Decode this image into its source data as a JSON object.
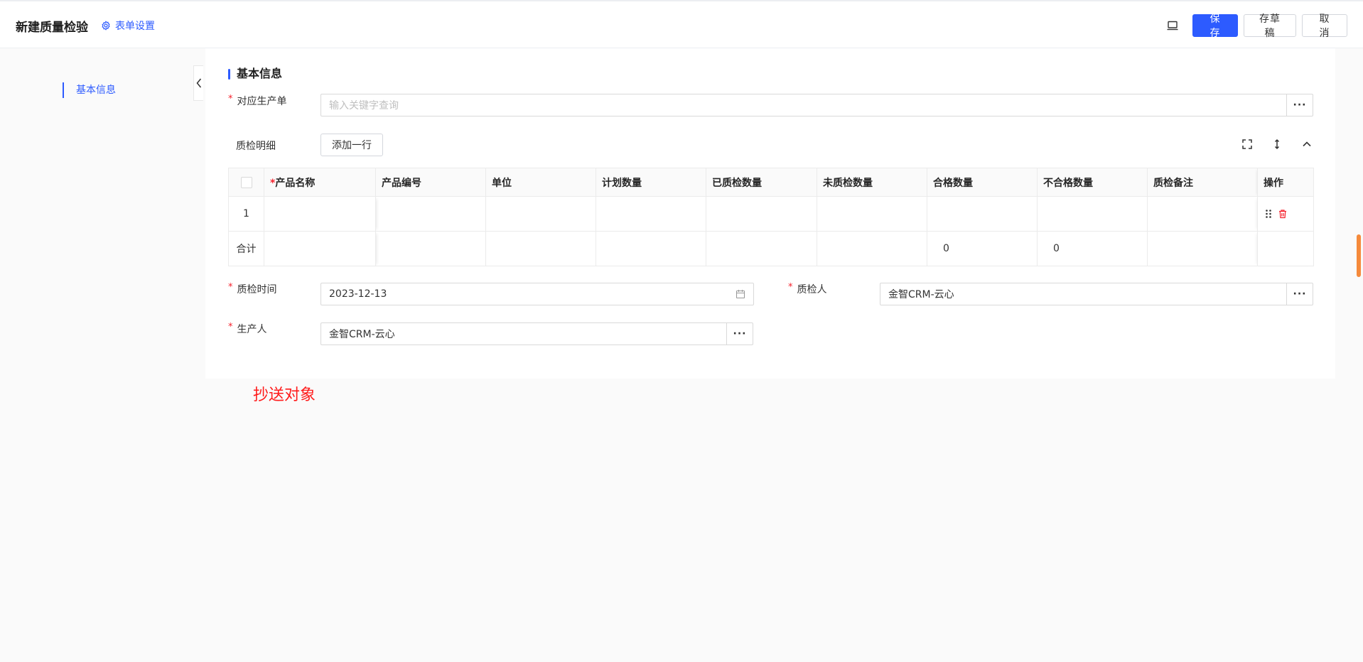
{
  "header": {
    "title": "新建质量检验",
    "form_settings": "表单设置",
    "save": "保 存",
    "draft": "存草稿",
    "cancel": "取 消"
  },
  "nav": {
    "items": [
      {
        "label": "基本信息",
        "active": true
      }
    ]
  },
  "section": {
    "title": "基本信息",
    "production_order": {
      "label": "对应生产单",
      "placeholder": "输入关键字查询",
      "more": "···"
    },
    "details": {
      "label": "质检明细",
      "add_row": "添加一行"
    },
    "table": {
      "required_mark": "*",
      "columns": [
        "产品名称",
        "产品编号",
        "单位",
        "计划数量",
        "已质检数量",
        "未质检数量",
        "合格数量",
        "不合格数量",
        "质检备注",
        "操作"
      ],
      "rows": [
        {
          "index": "1",
          "cells": [
            "",
            "",
            "",
            "",
            "",
            "",
            "",
            "",
            ""
          ]
        }
      ],
      "total": {
        "label": "合计",
        "cells": [
          "",
          "",
          "",
          "",
          "",
          "",
          "0",
          "0",
          "",
          ""
        ]
      }
    },
    "inspect_time": {
      "label": "质检时间",
      "value": "2023-12-13"
    },
    "inspector": {
      "label": "质检人",
      "value": "金智CRM-云心",
      "more": "···"
    },
    "producer": {
      "label": "生产人",
      "value": "金智CRM-云心",
      "more": "···"
    }
  },
  "cc": {
    "title": "抄送对象"
  },
  "colors": {
    "primary": "#2d5bff",
    "required": "#f5222d",
    "cc_title": "#ff1a1a",
    "scroll_thumb": "#f58a3b"
  }
}
